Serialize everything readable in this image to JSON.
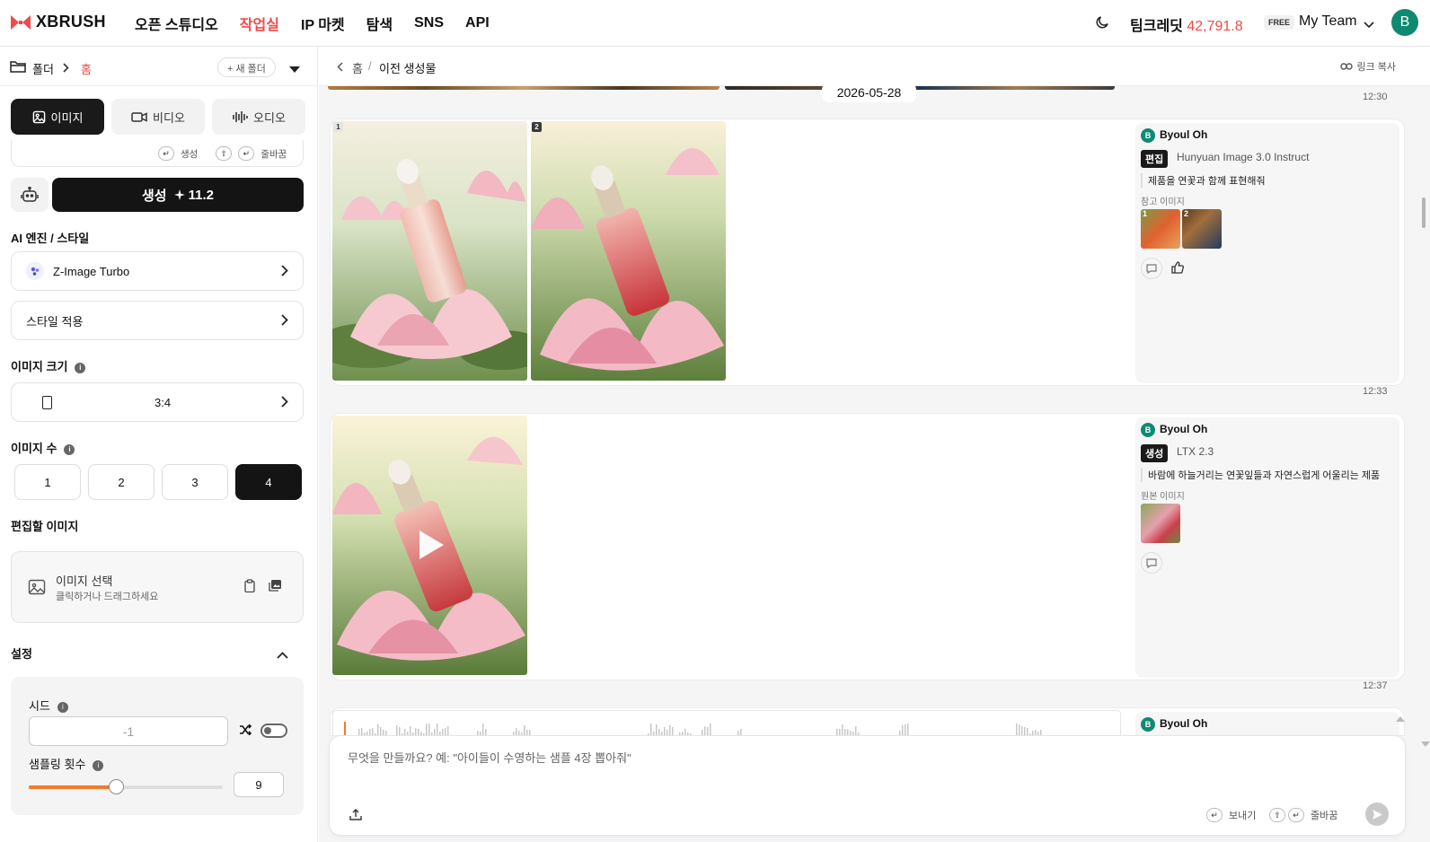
{
  "header": {
    "logo": "XBRUSH",
    "nav": [
      "오픈 스튜디오",
      "작업실",
      "IP 마켓",
      "탐색",
      "SNS",
      "API"
    ],
    "active_nav_index": 1,
    "credit_label": "팀크레딧",
    "credit_value": "42,791.8",
    "plan_badge": "FREE",
    "team_name": "My Team",
    "avatar_letter": "B"
  },
  "sidebar": {
    "folder_label": "폴더",
    "folder_current": "홈",
    "new_folder": "+ 새 폴더",
    "tabs": [
      "이미지",
      "비디오",
      "오디오"
    ],
    "active_tab": 0,
    "shortcut_generate": "생성",
    "shortcut_newline": "줄바꿈",
    "generate_label": "생성",
    "generate_cost": "11.2",
    "engine_section": "AI 엔진 / 스타일",
    "engine_value": "Z-Image Turbo",
    "style_value": "스타일 적용",
    "size_section": "이미지 크기",
    "size_value": "3:4",
    "count_section": "이미지 수",
    "counts": [
      "1",
      "2",
      "3",
      "4"
    ],
    "active_count": 3,
    "edit_section": "편집할 이미지",
    "drop_title": "이미지 선택",
    "drop_sub": "클릭하거나 드래그하세요",
    "settings_section": "설정",
    "seed_label": "시드",
    "seed_placeholder": "-1",
    "sampling_label": "샘플링 횟수",
    "sampling_value": "9",
    "sampling_fraction": 0.45
  },
  "main": {
    "breadcrumb_home": "홈",
    "breadcrumb_sep": "/",
    "breadcrumb_current": "이전 생성물",
    "copy_link": "링크 복사",
    "date": "2026-05-28",
    "time_top": "12:30",
    "cards": [
      {
        "user": "Byoul Oh",
        "badge": "편집",
        "model": "Hunyuan Image 3.0 Instruct",
        "prompt": "제품을 연꽃과 함께 표현해줘",
        "ref_label": "참고 이미지",
        "thumb_numbers": [
          "1",
          "2"
        ],
        "image_numbers": [
          "1",
          "2"
        ],
        "time": "12:33"
      },
      {
        "user": "Byoul Oh",
        "badge": "생성",
        "model": "LTX 2.3",
        "prompt": "바람에 하늘거리는 연꽃잎들과 자연스럽게 어울리는 제품",
        "ref_label": "원본 이미지",
        "time": "12:37"
      },
      {
        "user": "Byoul Oh"
      }
    ],
    "composer_placeholder": "무엇을 만들까요? 예: \"아이들이 수영하는 샘플 4장 뽑아줘\"",
    "send_hint": "보내기",
    "newline_hint": "줄바꿈"
  },
  "colors": {
    "accent": "#f04a4a",
    "dark": "#141414",
    "avatar": "#0f8a72",
    "slider": "#f07a2e"
  }
}
